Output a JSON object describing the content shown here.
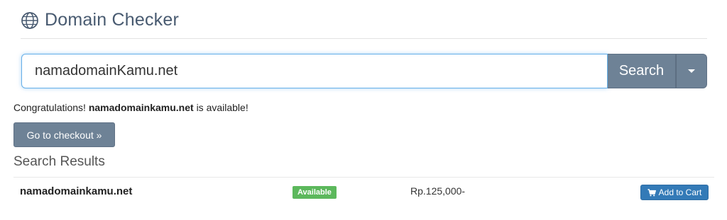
{
  "header": {
    "title": "Domain Checker",
    "icon": "globe-icon"
  },
  "search": {
    "value": "namadomainKamu.net",
    "button_label": "Search",
    "dropdown_icon": "caret-down-icon"
  },
  "message": {
    "prefix": "Congratulations!",
    "domain": "namadomainkamu.net",
    "suffix": "is available!"
  },
  "checkout": {
    "label": "Go to checkout »"
  },
  "results": {
    "title": "Search Results",
    "items": [
      {
        "domain": "namadomainkamu.net",
        "status": "Available",
        "price": "Rp.125,000-",
        "action_label": "Add to Cart",
        "action_icon": "cart-icon"
      }
    ]
  },
  "colors": {
    "primary_gray": "#6e8296",
    "title_color": "#485a70",
    "available_green": "#5cb85c",
    "cart_blue": "#337ab7",
    "input_focus": "#66afe9"
  }
}
